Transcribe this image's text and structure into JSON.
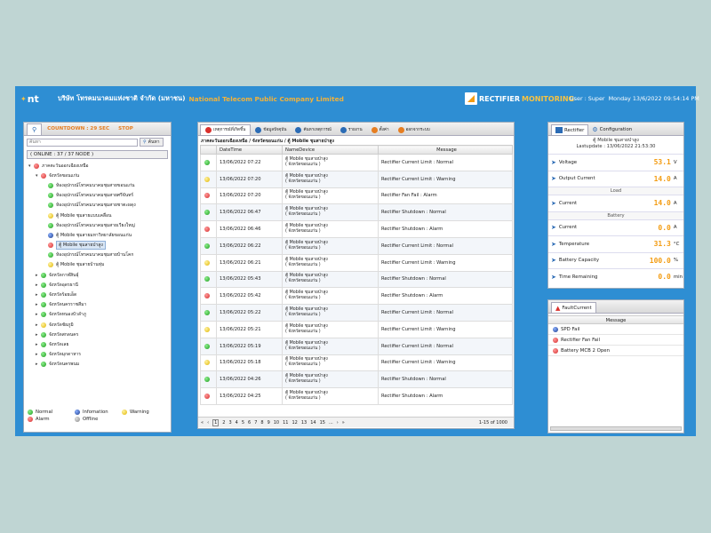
{
  "header": {
    "logo": "nt",
    "company_th": "บริษัท โทรคมนาคมแห่งชาติ จำกัด (มหาชน)",
    "company_en": "National Telecom Public Company Limited",
    "brand_a": "RECTIFIER",
    "brand_b": "MONITORING",
    "user": "User : Super",
    "datetime": "Monday 13/6/2022 09:54:14 PM"
  },
  "left": {
    "countdown": "COUNTDOWN : 29 SEC",
    "stop": "STOP",
    "search_placeholder": "ค้นหา",
    "search_button": "ค้นหา",
    "online": "( ONLINE : 37 / 37 NODE )",
    "tree": [
      {
        "level": 0,
        "arrow": "▾",
        "status": "red",
        "label": "ภาคตะวันออกเฉียงเหนือ"
      },
      {
        "level": 1,
        "arrow": "▾",
        "status": "red",
        "label": "จังหวัดขอนแก่น"
      },
      {
        "level": 2,
        "arrow": "",
        "status": "green",
        "label": "ห้องอุปกรณ์โทรคมนาคมชุมสายขอนแก่น"
      },
      {
        "level": 2,
        "arrow": "",
        "status": "green",
        "label": "ห้องอุปกรณ์โทรคมนาคมชุมสายศรีจันทร์"
      },
      {
        "level": 2,
        "arrow": "",
        "status": "green",
        "label": "ห้องอุปกรณ์โทรคมนาคมชุมสายชาตะผดุง"
      },
      {
        "level": 2,
        "arrow": "",
        "status": "yellow",
        "label": "ตู้ Mobile ชุมสายแบบเคลื่อน"
      },
      {
        "level": 2,
        "arrow": "",
        "status": "green",
        "label": "ห้องอุปกรณ์โทรคมนาคมชุมสายเวียงใหญ่"
      },
      {
        "level": 2,
        "arrow": "",
        "status": "blue",
        "label": "ตู้ Mobile ชุมสายมหาวิทยาลัยขอนแก่น"
      },
      {
        "level": 2,
        "arrow": "",
        "status": "red",
        "label": "ตู้ Mobile ชุมสายป่าสูง",
        "selected": true
      },
      {
        "level": 2,
        "arrow": "",
        "status": "green",
        "label": "ห้องอุปกรณ์โทรคมนาคมชุมสายบ้านโคก"
      },
      {
        "level": 2,
        "arrow": "",
        "status": "yellow",
        "label": "ตู้ Mobile ชุมสายบ้านทุ่ม"
      },
      {
        "level": 1,
        "arrow": "▸",
        "status": "green",
        "label": "จังหวัดกาฬสินธุ์"
      },
      {
        "level": 1,
        "arrow": "▸",
        "status": "green",
        "label": "จังหวัดอุดรธานี"
      },
      {
        "level": 1,
        "arrow": "▸",
        "status": "green",
        "label": "จังหวัดร้อยเอ็ด"
      },
      {
        "level": 1,
        "arrow": "▸",
        "status": "green",
        "label": "จังหวัดนครราชสีมา"
      },
      {
        "level": 1,
        "arrow": "▸",
        "status": "green",
        "label": "จังหวัดหนองบัวลำภู"
      },
      {
        "level": 1,
        "arrow": "▸",
        "status": "yellow",
        "label": "จังหวัดชัยภูมิ"
      },
      {
        "level": 1,
        "arrow": "▸",
        "status": "green",
        "label": "จังหวัดสกลนคร"
      },
      {
        "level": 1,
        "arrow": "▸",
        "status": "green",
        "label": "จังหวัดเลย"
      },
      {
        "level": 1,
        "arrow": "▸",
        "status": "green",
        "label": "จังหวัดมุกดาหาร"
      },
      {
        "level": 1,
        "arrow": "▸",
        "status": "green",
        "label": "จังหวัดนครพนม"
      }
    ],
    "legend": [
      {
        "status": "green",
        "label": "Normal"
      },
      {
        "status": "blue",
        "label": "Infomation"
      },
      {
        "status": "yellow",
        "label": "Warning"
      },
      {
        "status": "red",
        "label": "Alarm"
      },
      {
        "status": "gray",
        "label": "Offline"
      }
    ]
  },
  "mid": {
    "tabs": [
      {
        "label": "เหตุการณ์ที่เกิดขึ้น",
        "icon": "alarm-icon",
        "color": "#d9302c",
        "active": true
      },
      {
        "label": "ข้อมูลปัจจุบัน",
        "icon": "gauge-icon",
        "color": "#2b6bb5",
        "active": false
      },
      {
        "label": "ค้นหาเหตุการณ์",
        "icon": "search-icon",
        "color": "#2b6bb5",
        "active": false
      },
      {
        "label": "รายงาน",
        "icon": "report-icon",
        "color": "#2b6bb5",
        "active": false
      },
      {
        "label": "ตั้งค่า",
        "icon": "gear-icon",
        "color": "#e67e22",
        "active": false
      },
      {
        "label": "ออกจากระบบ",
        "icon": "logout-icon",
        "color": "#e67e22",
        "active": false
      }
    ],
    "breadcrumb": "ภาคตะวันออกเฉียงเหนือ / จังหวัดขอนแก่น / ตู้ Mobile ชุมสายป่าสูง",
    "columns": [
      "DateTime",
      "NameDevice",
      "Message"
    ],
    "rows": [
      {
        "status": "green",
        "datetime": "13/06/2022 07:22",
        "device1": "ตู้ Mobile ชุมสายป่าสูง",
        "device2": "( จังหวัดขอนแก่น )",
        "message": "Rectifier Current Limit : Normal"
      },
      {
        "status": "yellow",
        "datetime": "13/06/2022 07:20",
        "device1": "ตู้ Mobile ชุมสายป่าสูง",
        "device2": "( จังหวัดขอนแก่น )",
        "message": "Rectifier Current Limit : Warning"
      },
      {
        "status": "red",
        "datetime": "13/06/2022 07:20",
        "device1": "ตู้ Mobile ชุมสายป่าสูง",
        "device2": "( จังหวัดขอนแก่น )",
        "message": "Rectifier Fan Fail : Alarm"
      },
      {
        "status": "green",
        "datetime": "13/06/2022 06:47",
        "device1": "ตู้ Mobile ชุมสายป่าสูง",
        "device2": "( จังหวัดขอนแก่น )",
        "message": "Rectifier Shutdown : Normal"
      },
      {
        "status": "red",
        "datetime": "13/06/2022 06:46",
        "device1": "ตู้ Mobile ชุมสายป่าสูง",
        "device2": "( จังหวัดขอนแก่น )",
        "message": "Rectifier Shutdown : Alarm"
      },
      {
        "status": "green",
        "datetime": "13/06/2022 06:22",
        "device1": "ตู้ Mobile ชุมสายป่าสูง",
        "device2": "( จังหวัดขอนแก่น )",
        "message": "Rectifier Current Limit : Normal"
      },
      {
        "status": "yellow",
        "datetime": "13/06/2022 06:21",
        "device1": "ตู้ Mobile ชุมสายป่าสูง",
        "device2": "( จังหวัดขอนแก่น )",
        "message": "Rectifier Current Limit : Warning"
      },
      {
        "status": "green",
        "datetime": "13/06/2022 05:43",
        "device1": "ตู้ Mobile ชุมสายป่าสูง",
        "device2": "( จังหวัดขอนแก่น )",
        "message": "Rectifier Shutdown : Normal"
      },
      {
        "status": "red",
        "datetime": "13/06/2022 05:42",
        "device1": "ตู้ Mobile ชุมสายป่าสูง",
        "device2": "( จังหวัดขอนแก่น )",
        "message": "Rectifier Shutdown : Alarm"
      },
      {
        "status": "green",
        "datetime": "13/06/2022 05:22",
        "device1": "ตู้ Mobile ชุมสายป่าสูง",
        "device2": "( จังหวัดขอนแก่น )",
        "message": "Rectifier Current Limit : Normal"
      },
      {
        "status": "yellow",
        "datetime": "13/06/2022 05:21",
        "device1": "ตู้ Mobile ชุมสายป่าสูง",
        "device2": "( จังหวัดขอนแก่น )",
        "message": "Rectifier Current Limit : Warning"
      },
      {
        "status": "green",
        "datetime": "13/06/2022 05:19",
        "device1": "ตู้ Mobile ชุมสายป่าสูง",
        "device2": "( จังหวัดขอนแก่น )",
        "message": "Rectifier Current Limit : Normal"
      },
      {
        "status": "yellow",
        "datetime": "13/06/2022 05:18",
        "device1": "ตู้ Mobile ชุมสายป่าสูง",
        "device2": "( จังหวัดขอนแก่น )",
        "message": "Rectifier Current Limit : Warning"
      },
      {
        "status": "green",
        "datetime": "13/06/2022 04:26",
        "device1": "ตู้ Mobile ชุมสายป่าสูง",
        "device2": "( จังหวัดขอนแก่น )",
        "message": "Rectifier Shutdown : Normal"
      },
      {
        "status": "red",
        "datetime": "13/06/2022 04:25",
        "device1": "ตู้ Mobile ชุมสายป่าสูง",
        "device2": "( จังหวัดขอนแก่น )",
        "message": "Rectifier Shutdown : Alarm"
      }
    ],
    "pager": {
      "first": "«",
      "prev": "‹",
      "next": "›",
      "last": "»",
      "pages": [
        "1",
        "2",
        "3",
        "4",
        "5",
        "6",
        "7",
        "8",
        "9",
        "10",
        "11",
        "12",
        "13",
        "14",
        "15",
        "..."
      ],
      "current": "1",
      "count": "1-15 of 1000"
    }
  },
  "right": {
    "tabs": [
      {
        "label": "Rectifier",
        "icon": "rectifier-icon",
        "active": true
      },
      {
        "label": "Configuration",
        "icon": "gear-icon",
        "active": false
      }
    ],
    "device": "ตู้ Mobile ชุมสายป่าสูง",
    "lastupdate": "Lastupdate : 13/06/2022 21:53:30",
    "metrics_top": [
      {
        "label": "Voltage",
        "value": "53.1",
        "unit": "V"
      },
      {
        "label": "Output Current",
        "value": "14.0",
        "unit": "A"
      }
    ],
    "load_title": "Load",
    "metrics_load": [
      {
        "label": "Current",
        "value": "14.0",
        "unit": "A"
      }
    ],
    "battery_title": "Battery",
    "metrics_battery": [
      {
        "label": "Current",
        "value": "0.0",
        "unit": "A"
      },
      {
        "label": "Temperature",
        "value": "31.3",
        "unit": "°C"
      },
      {
        "label": "Battery Capacity",
        "value": "100.0",
        "unit": "%"
      },
      {
        "label": "Time Remaining",
        "value": "0.0",
        "unit": "min"
      }
    ],
    "fault_tab": "FaultCurrent",
    "fault_header": "Message",
    "faults": [
      {
        "status": "blue",
        "label": "SPD Fail"
      },
      {
        "status": "red",
        "label": "Rectifier Fan Fail"
      },
      {
        "status": "red",
        "label": "Battery MCB 2 Open"
      }
    ]
  }
}
